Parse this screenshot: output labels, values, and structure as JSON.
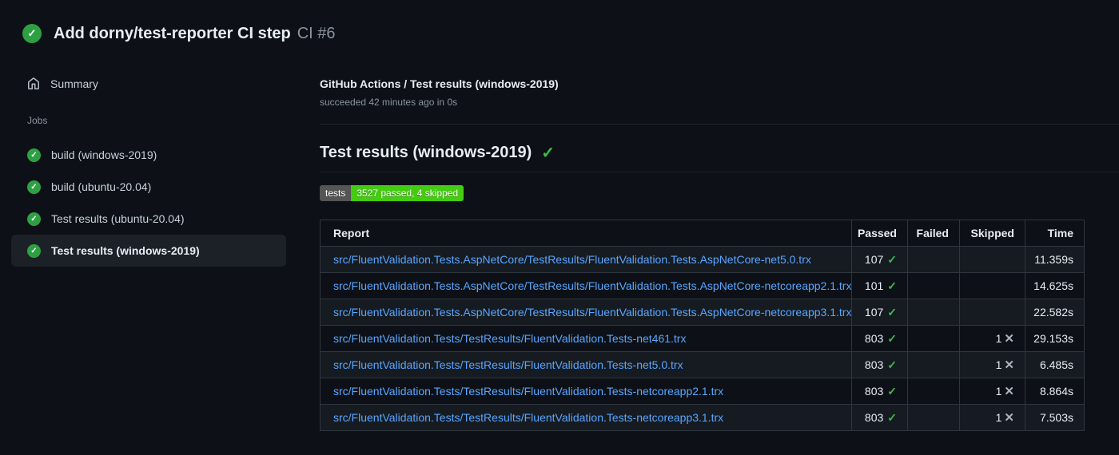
{
  "colors": {
    "background": "#0d1117",
    "text_primary": "#e6edf3",
    "text_secondary": "#8b949e",
    "link": "#58a6ff",
    "success": "#3fb950",
    "success_icon_bg": "#2ea043",
    "divider": "#21262d",
    "table_border": "#30363d",
    "row_alt": "#161b22",
    "selected_bg": "#1c2128",
    "badge_label_bg": "#555555",
    "badge_value_bg": "#44cc11",
    "x_mark": "#a8b3bd"
  },
  "header": {
    "title": "Add dorny/test-reporter CI step",
    "run_number": "CI #6",
    "status_icon": "check-circle",
    "check_glyph": "✓"
  },
  "sidebar": {
    "summary_label": "Summary",
    "jobs_label": "Jobs",
    "jobs": [
      {
        "label": "build (windows-2019)",
        "selected": false
      },
      {
        "label": "build (ubuntu-20.04)",
        "selected": false
      },
      {
        "label": "Test results (ubuntu-20.04)",
        "selected": false
      },
      {
        "label": "Test results (windows-2019)",
        "selected": true
      }
    ]
  },
  "main": {
    "check_title": "GitHub Actions / Test results (windows-2019)",
    "check_status": "succeeded 42 minutes ago in 0s",
    "section_title": "Test results (windows-2019)",
    "section_check_glyph": "✓",
    "badge": {
      "label": "tests",
      "value": "3527 passed, 4 skipped"
    },
    "table": {
      "columns": [
        "Report",
        "Passed",
        "Failed",
        "Skipped",
        "Time"
      ],
      "pass_glyph": "✓",
      "skip_glyph": "✕",
      "rows": [
        {
          "report": "src/FluentValidation.Tests.AspNetCore/TestResults/FluentValidation.Tests.AspNetCore-net5.0.trx",
          "passed": "107",
          "failed": "",
          "skipped": "",
          "time": "11.359s"
        },
        {
          "report": "src/FluentValidation.Tests.AspNetCore/TestResults/FluentValidation.Tests.AspNetCore-netcoreapp2.1.trx",
          "passed": "101",
          "failed": "",
          "skipped": "",
          "time": "14.625s"
        },
        {
          "report": "src/FluentValidation.Tests.AspNetCore/TestResults/FluentValidation.Tests.AspNetCore-netcoreapp3.1.trx",
          "passed": "107",
          "failed": "",
          "skipped": "",
          "time": "22.582s"
        },
        {
          "report": "src/FluentValidation.Tests/TestResults/FluentValidation.Tests-net461.trx",
          "passed": "803",
          "failed": "",
          "skipped": "1",
          "time": "29.153s"
        },
        {
          "report": "src/FluentValidation.Tests/TestResults/FluentValidation.Tests-net5.0.trx",
          "passed": "803",
          "failed": "",
          "skipped": "1",
          "time": "6.485s"
        },
        {
          "report": "src/FluentValidation.Tests/TestResults/FluentValidation.Tests-netcoreapp2.1.trx",
          "passed": "803",
          "failed": "",
          "skipped": "1",
          "time": "8.864s"
        },
        {
          "report": "src/FluentValidation.Tests/TestResults/FluentValidation.Tests-netcoreapp3.1.trx",
          "passed": "803",
          "failed": "",
          "skipped": "1",
          "time": "7.503s"
        }
      ]
    }
  }
}
